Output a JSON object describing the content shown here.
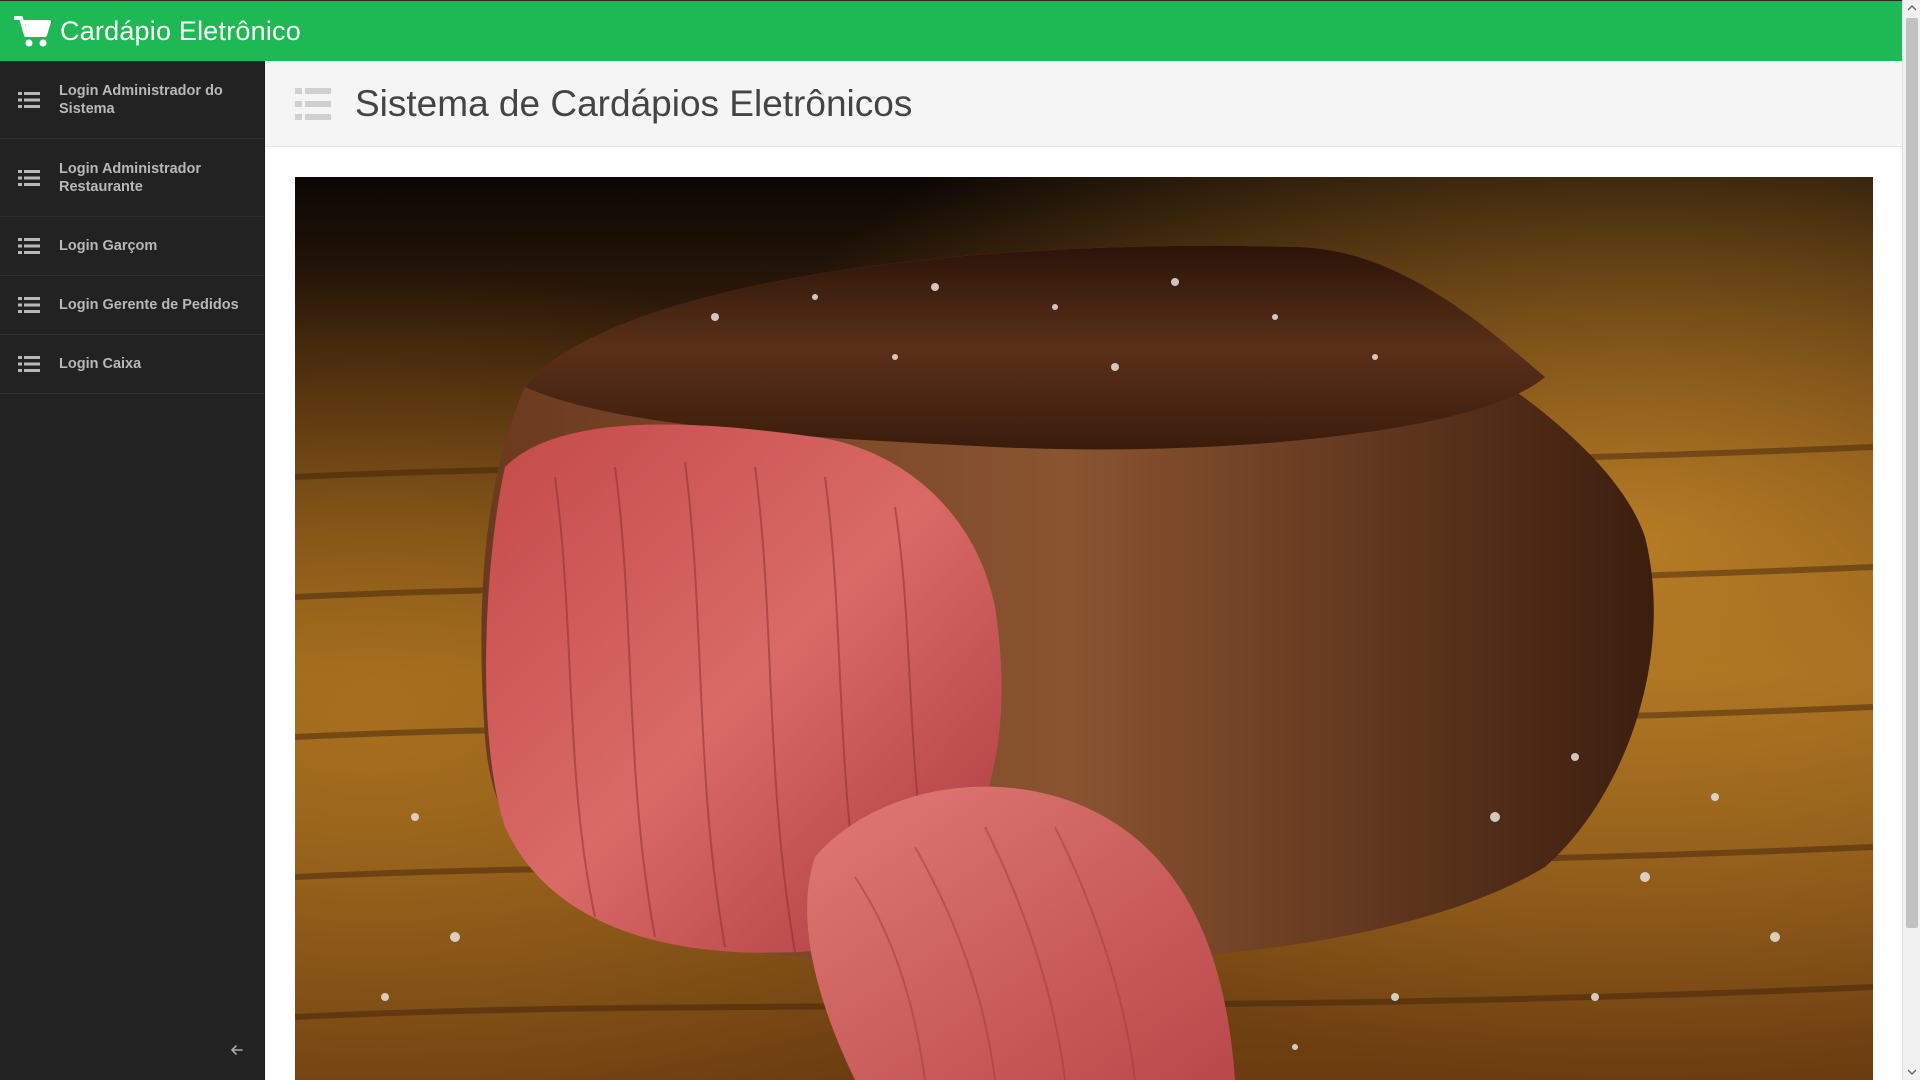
{
  "navbar": {
    "brand_title": "Cardápio Eletrônico",
    "brand_icon": "shopping-cart-icon",
    "background_color": "#1eb854"
  },
  "sidebar": {
    "items": [
      {
        "label": "Login Administrador do Sistema",
        "icon": "list-icon"
      },
      {
        "label": "Login Administrador Restaurante",
        "icon": "list-icon"
      },
      {
        "label": "Login Garçom",
        "icon": "list-icon"
      },
      {
        "label": "Login Gerente de Pedidos",
        "icon": "list-icon"
      },
      {
        "label": "Login Caixa",
        "icon": "list-icon"
      }
    ],
    "collapse_icon": "arrow-left-icon"
  },
  "main": {
    "title": "Sistema de Cardápios Eletrônicos",
    "title_icon": "list-icon",
    "hero_image": "steak-on-wooden-board"
  }
}
